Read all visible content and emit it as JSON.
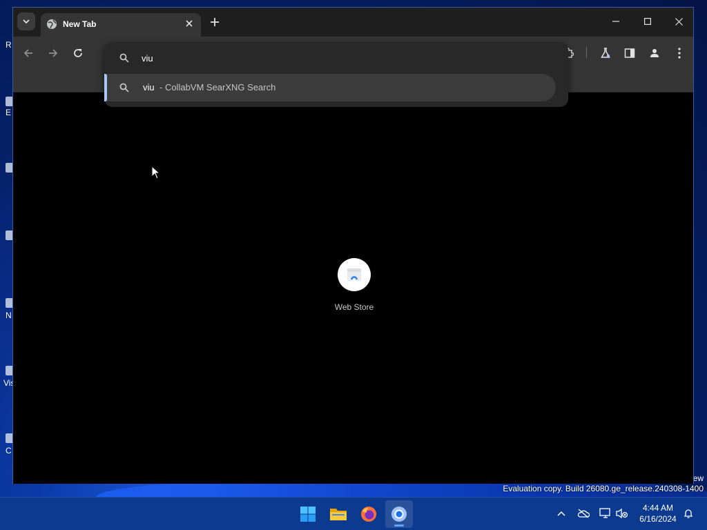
{
  "desktop": {
    "labels": [
      "R",
      "E",
      "N",
      "Vis",
      "C"
    ],
    "watermark_top": "ew",
    "watermark": "Evaluation copy. Build 26080.ge_release.240308-1400"
  },
  "browser": {
    "tab": {
      "title": "New Tab",
      "favicon": "globe-icon"
    },
    "toolbar": {
      "back": "arrow-left-icon",
      "forward": "arrow-right-icon",
      "reload": "reload-icon",
      "extensions": "puzzle-icon",
      "labs": "flask-icon",
      "side_panel": "side-panel-icon",
      "profile": "person-icon",
      "menu": "kebab-menu-icon"
    },
    "omnibox": {
      "value": "viu",
      "suggestion": {
        "query": "viu",
        "description": "- CollabVM SearXNG Search"
      }
    },
    "shortcuts": [
      {
        "label": "Web Store",
        "icon": "web-store-icon"
      }
    ]
  },
  "taskbar": {
    "apps": [
      "start-icon",
      "file-explorer-icon",
      "firefox-icon",
      "chrome-icon"
    ],
    "tray": [
      "chevron-up-icon",
      "onedrive-icon",
      "network-icon",
      "volume-muted-icon",
      "bell-icon"
    ],
    "clock": {
      "time": "4:44 AM",
      "date": "6/16/2024"
    }
  },
  "colors": {
    "accent": "#a8c7fa",
    "taskbar": "#0c3a8f",
    "toolbar": "#353535"
  }
}
